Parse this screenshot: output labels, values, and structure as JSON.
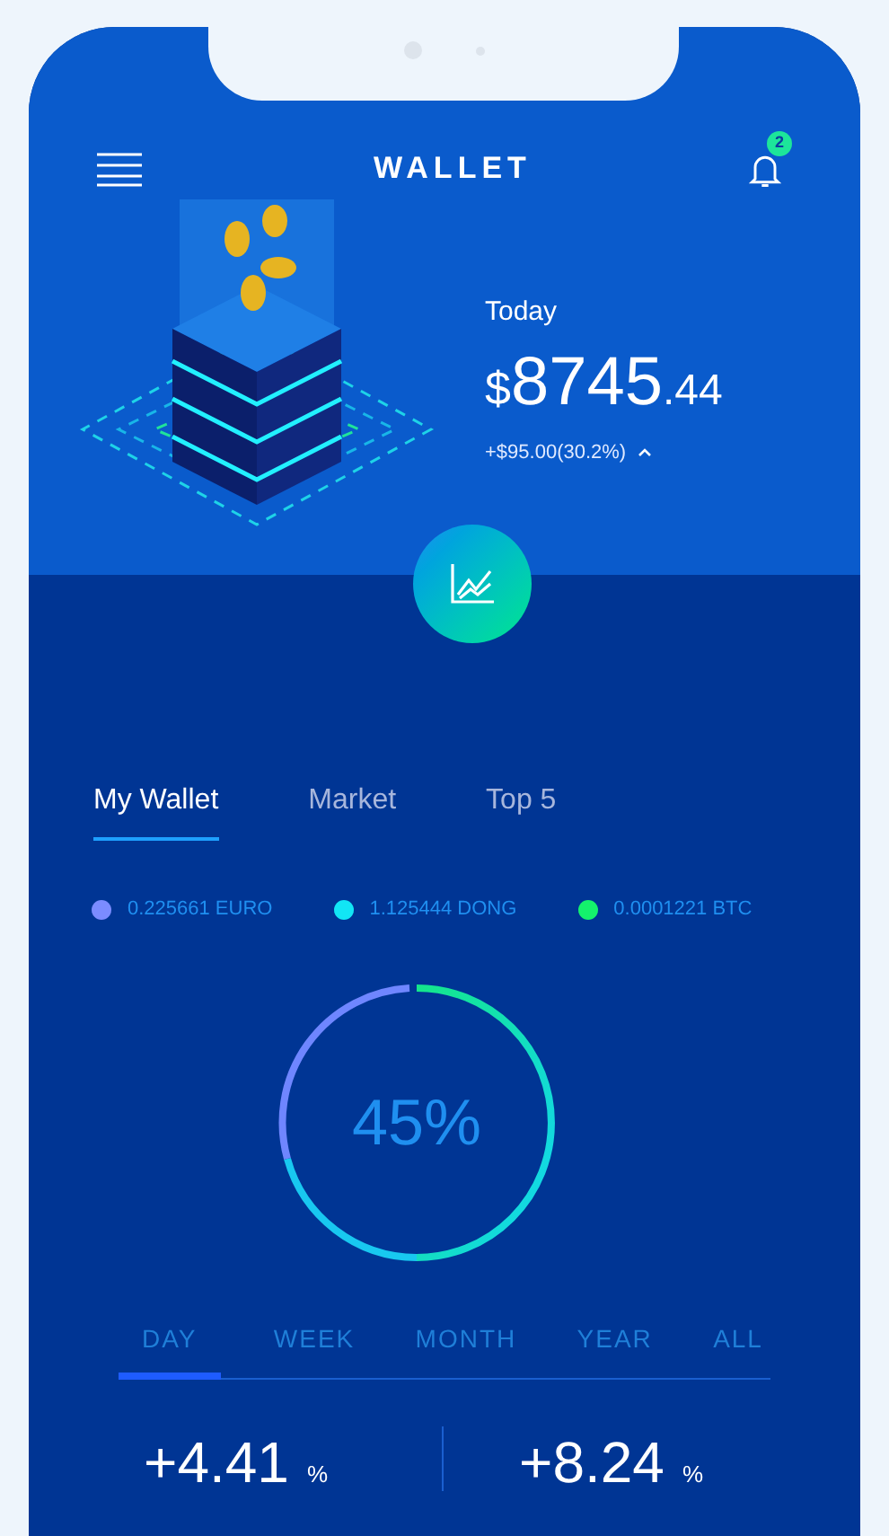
{
  "header": {
    "title": "WALLET",
    "notification_count": "2"
  },
  "balance": {
    "label": "Today",
    "currency": "$",
    "integer": "8745",
    "decimal": ".44",
    "change": "+$95.00(30.2%)"
  },
  "tabs": [
    {
      "label": "My Wallet",
      "selected": true
    },
    {
      "label": "Market",
      "selected": false
    },
    {
      "label": "Top 5",
      "selected": false
    }
  ],
  "legend": [
    {
      "label": "0.225661 EURO",
      "color": "#7b8cff"
    },
    {
      "label": "1.125444 DONG",
      "color": "#12e6f5"
    },
    {
      "label": "0.0001221 BTC",
      "color": "#14f26c"
    }
  ],
  "donut": {
    "value": "45%"
  },
  "periods": [
    {
      "label": "DAY",
      "selected": true
    },
    {
      "label": "WEEK",
      "selected": false
    },
    {
      "label": "MONTH",
      "selected": false
    },
    {
      "label": "YEAR",
      "selected": false
    },
    {
      "label": "ALL",
      "selected": false
    }
  ],
  "stats": [
    {
      "value": "+4.41",
      "unit": "%"
    },
    {
      "value": "+8.24",
      "unit": "%"
    }
  ]
}
